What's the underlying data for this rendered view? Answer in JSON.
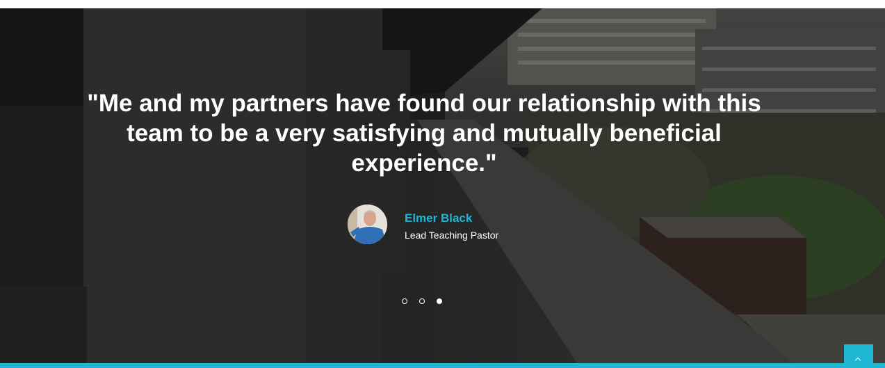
{
  "testimonial": {
    "quote": "\"Me and my partners have found our relationship with this team to be a very satisfying and mutually beneficial experience.\"",
    "author_name": "Elmer Black",
    "author_role": "Lead Teaching Pastor"
  },
  "carousel": {
    "slide_count": 3,
    "active_index": 2
  },
  "colors": {
    "accent": "#1fb7d4",
    "text": "#ffffff"
  },
  "icons": {
    "scroll_top": "chevron-up-icon"
  }
}
